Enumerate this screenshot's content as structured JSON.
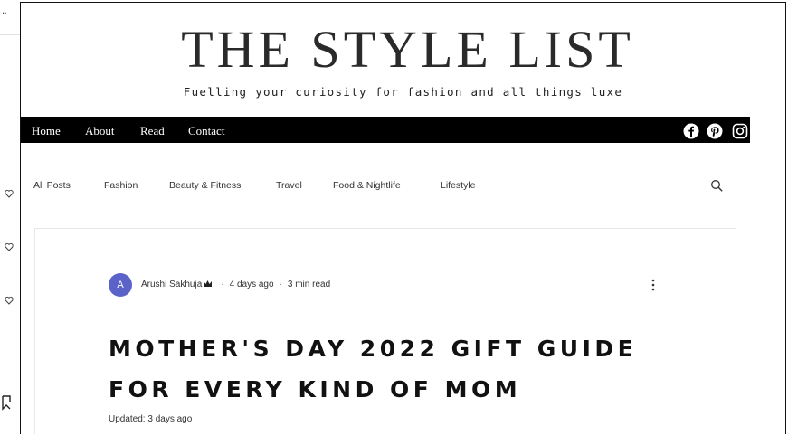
{
  "site": {
    "title": "THE STYLE LIST",
    "tagline": "Fuelling your curiosity for fashion and all things luxe"
  },
  "gutter": {
    "dots": "..",
    "icons": [
      "heart-icon",
      "heart-icon",
      "heart-icon",
      "share-icon"
    ]
  },
  "nav": {
    "items": [
      {
        "label": "Home"
      },
      {
        "label": "About"
      },
      {
        "label": "Read"
      },
      {
        "label": "Contact"
      }
    ],
    "social_icons": [
      "facebook-icon",
      "pinterest-icon",
      "instagram-icon"
    ]
  },
  "categories": {
    "items": [
      {
        "label": "All Posts"
      },
      {
        "label": "Fashion"
      },
      {
        "label": "Beauty & Fitness"
      },
      {
        "label": "Travel"
      },
      {
        "label": "Food & Nightlife"
      },
      {
        "label": "Lifestyle"
      }
    ],
    "search_icon": "search-icon"
  },
  "post": {
    "avatar_initial": "A",
    "author": "Arushi Sakhuja",
    "date": "4 days ago",
    "read_time": "3 min read",
    "title": "MOTHER'S DAY 2022 GIFT GUIDE FOR EVERY KIND OF MOM",
    "updated": "Updated: 3 days ago"
  },
  "colors": {
    "nav_bg": "#000000",
    "avatar_bg": "#5b63c9",
    "text": "#222222"
  }
}
